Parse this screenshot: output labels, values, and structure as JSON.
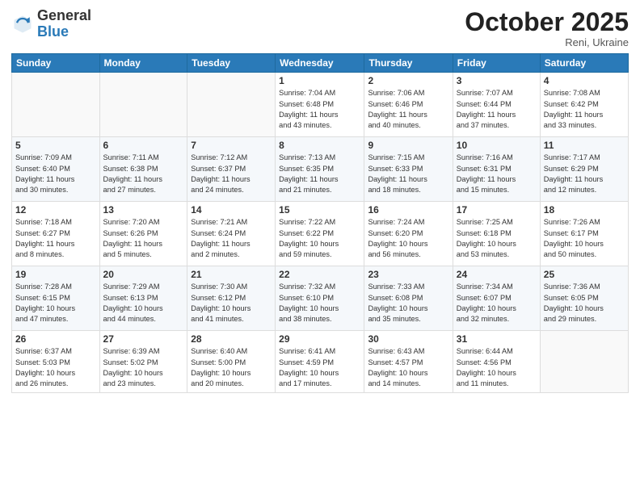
{
  "header": {
    "logo_general": "General",
    "logo_blue": "Blue",
    "month": "October 2025",
    "location": "Reni, Ukraine"
  },
  "weekdays": [
    "Sunday",
    "Monday",
    "Tuesday",
    "Wednesday",
    "Thursday",
    "Friday",
    "Saturday"
  ],
  "weeks": [
    [
      {
        "day": "",
        "info": ""
      },
      {
        "day": "",
        "info": ""
      },
      {
        "day": "",
        "info": ""
      },
      {
        "day": "1",
        "info": "Sunrise: 7:04 AM\nSunset: 6:48 PM\nDaylight: 11 hours\nand 43 minutes."
      },
      {
        "day": "2",
        "info": "Sunrise: 7:06 AM\nSunset: 6:46 PM\nDaylight: 11 hours\nand 40 minutes."
      },
      {
        "day": "3",
        "info": "Sunrise: 7:07 AM\nSunset: 6:44 PM\nDaylight: 11 hours\nand 37 minutes."
      },
      {
        "day": "4",
        "info": "Sunrise: 7:08 AM\nSunset: 6:42 PM\nDaylight: 11 hours\nand 33 minutes."
      }
    ],
    [
      {
        "day": "5",
        "info": "Sunrise: 7:09 AM\nSunset: 6:40 PM\nDaylight: 11 hours\nand 30 minutes."
      },
      {
        "day": "6",
        "info": "Sunrise: 7:11 AM\nSunset: 6:38 PM\nDaylight: 11 hours\nand 27 minutes."
      },
      {
        "day": "7",
        "info": "Sunrise: 7:12 AM\nSunset: 6:37 PM\nDaylight: 11 hours\nand 24 minutes."
      },
      {
        "day": "8",
        "info": "Sunrise: 7:13 AM\nSunset: 6:35 PM\nDaylight: 11 hours\nand 21 minutes."
      },
      {
        "day": "9",
        "info": "Sunrise: 7:15 AM\nSunset: 6:33 PM\nDaylight: 11 hours\nand 18 minutes."
      },
      {
        "day": "10",
        "info": "Sunrise: 7:16 AM\nSunset: 6:31 PM\nDaylight: 11 hours\nand 15 minutes."
      },
      {
        "day": "11",
        "info": "Sunrise: 7:17 AM\nSunset: 6:29 PM\nDaylight: 11 hours\nand 12 minutes."
      }
    ],
    [
      {
        "day": "12",
        "info": "Sunrise: 7:18 AM\nSunset: 6:27 PM\nDaylight: 11 hours\nand 8 minutes."
      },
      {
        "day": "13",
        "info": "Sunrise: 7:20 AM\nSunset: 6:26 PM\nDaylight: 11 hours\nand 5 minutes."
      },
      {
        "day": "14",
        "info": "Sunrise: 7:21 AM\nSunset: 6:24 PM\nDaylight: 11 hours\nand 2 minutes."
      },
      {
        "day": "15",
        "info": "Sunrise: 7:22 AM\nSunset: 6:22 PM\nDaylight: 10 hours\nand 59 minutes."
      },
      {
        "day": "16",
        "info": "Sunrise: 7:24 AM\nSunset: 6:20 PM\nDaylight: 10 hours\nand 56 minutes."
      },
      {
        "day": "17",
        "info": "Sunrise: 7:25 AM\nSunset: 6:18 PM\nDaylight: 10 hours\nand 53 minutes."
      },
      {
        "day": "18",
        "info": "Sunrise: 7:26 AM\nSunset: 6:17 PM\nDaylight: 10 hours\nand 50 minutes."
      }
    ],
    [
      {
        "day": "19",
        "info": "Sunrise: 7:28 AM\nSunset: 6:15 PM\nDaylight: 10 hours\nand 47 minutes."
      },
      {
        "day": "20",
        "info": "Sunrise: 7:29 AM\nSunset: 6:13 PM\nDaylight: 10 hours\nand 44 minutes."
      },
      {
        "day": "21",
        "info": "Sunrise: 7:30 AM\nSunset: 6:12 PM\nDaylight: 10 hours\nand 41 minutes."
      },
      {
        "day": "22",
        "info": "Sunrise: 7:32 AM\nSunset: 6:10 PM\nDaylight: 10 hours\nand 38 minutes."
      },
      {
        "day": "23",
        "info": "Sunrise: 7:33 AM\nSunset: 6:08 PM\nDaylight: 10 hours\nand 35 minutes."
      },
      {
        "day": "24",
        "info": "Sunrise: 7:34 AM\nSunset: 6:07 PM\nDaylight: 10 hours\nand 32 minutes."
      },
      {
        "day": "25",
        "info": "Sunrise: 7:36 AM\nSunset: 6:05 PM\nDaylight: 10 hours\nand 29 minutes."
      }
    ],
    [
      {
        "day": "26",
        "info": "Sunrise: 6:37 AM\nSunset: 5:03 PM\nDaylight: 10 hours\nand 26 minutes."
      },
      {
        "day": "27",
        "info": "Sunrise: 6:39 AM\nSunset: 5:02 PM\nDaylight: 10 hours\nand 23 minutes."
      },
      {
        "day": "28",
        "info": "Sunrise: 6:40 AM\nSunset: 5:00 PM\nDaylight: 10 hours\nand 20 minutes."
      },
      {
        "day": "29",
        "info": "Sunrise: 6:41 AM\nSunset: 4:59 PM\nDaylight: 10 hours\nand 17 minutes."
      },
      {
        "day": "30",
        "info": "Sunrise: 6:43 AM\nSunset: 4:57 PM\nDaylight: 10 hours\nand 14 minutes."
      },
      {
        "day": "31",
        "info": "Sunrise: 6:44 AM\nSunset: 4:56 PM\nDaylight: 10 hours\nand 11 minutes."
      },
      {
        "day": "",
        "info": ""
      }
    ]
  ]
}
